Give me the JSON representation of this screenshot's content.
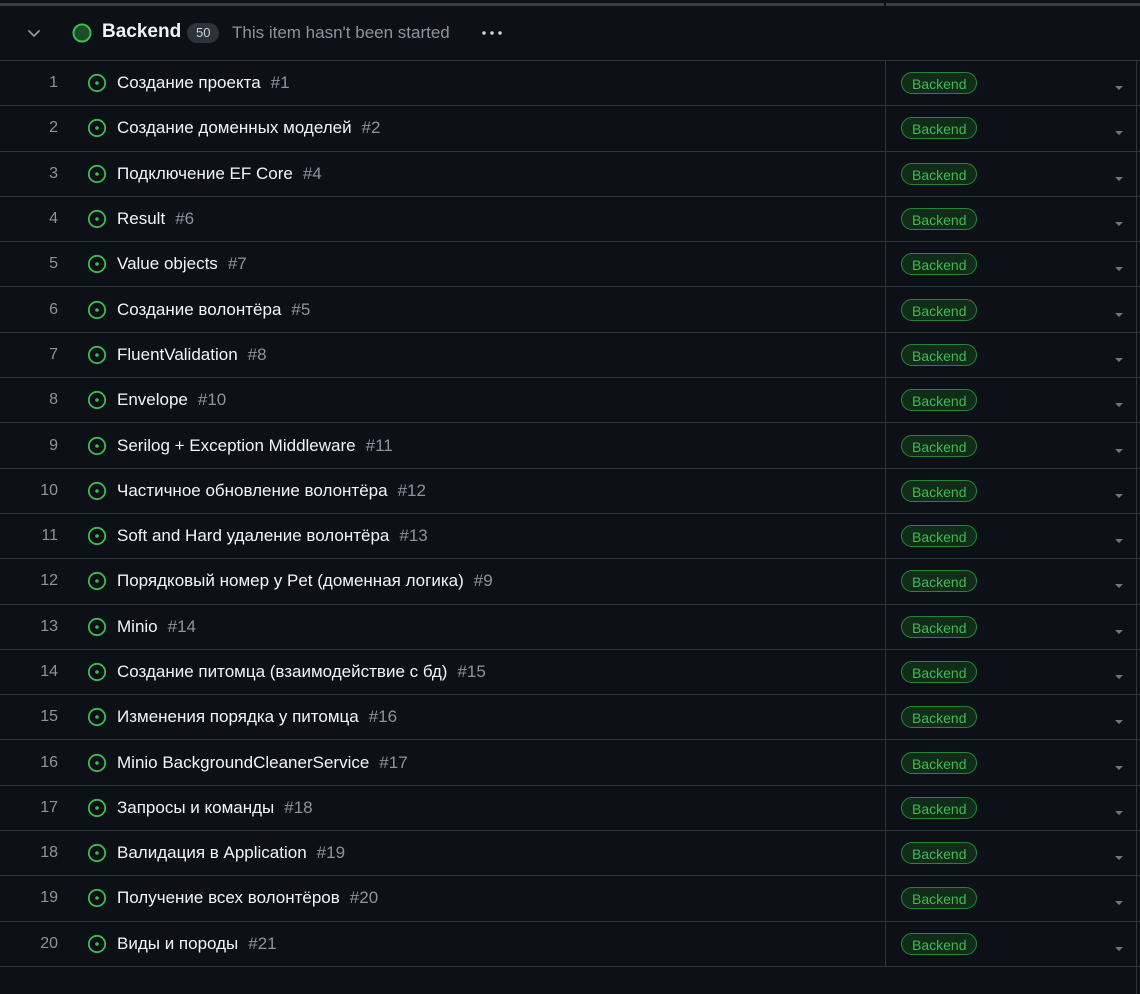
{
  "group": {
    "title": "Backend",
    "count": "50",
    "description": "This item hasn't been started"
  },
  "colors": {
    "background": "#0d1117",
    "label_text": "#3fb950",
    "status_green": "#3fb950"
  },
  "icons": {
    "collapse": "chevron-down-icon",
    "status": "status-circle-icon",
    "more": "kebab-menu-icon",
    "issue": "issue-open-icon",
    "dropdown": "dropdown-caret-icon"
  },
  "items": [
    {
      "num": "1",
      "title": "Создание проекта",
      "ref": "#1",
      "label": "Backend"
    },
    {
      "num": "2",
      "title": "Создание доменных моделей",
      "ref": "#2",
      "label": "Backend"
    },
    {
      "num": "3",
      "title": "Подключение EF Core",
      "ref": "#4",
      "label": "Backend"
    },
    {
      "num": "4",
      "title": "Result",
      "ref": "#6",
      "label": "Backend"
    },
    {
      "num": "5",
      "title": "Value objects",
      "ref": "#7",
      "label": "Backend"
    },
    {
      "num": "6",
      "title": "Создание волонтёра",
      "ref": "#5",
      "label": "Backend"
    },
    {
      "num": "7",
      "title": "FluentValidation",
      "ref": "#8",
      "label": "Backend"
    },
    {
      "num": "8",
      "title": "Envelope",
      "ref": "#10",
      "label": "Backend"
    },
    {
      "num": "9",
      "title": "Serilog + Exception Middleware",
      "ref": "#11",
      "label": "Backend"
    },
    {
      "num": "10",
      "title": "Частичное обновление волонтёра",
      "ref": "#12",
      "label": "Backend"
    },
    {
      "num": "11",
      "title": "Soft and Hard удаление волонтёра",
      "ref": "#13",
      "label": "Backend"
    },
    {
      "num": "12",
      "title": "Порядковый номер у Pet (доменная логика)",
      "ref": "#9",
      "label": "Backend"
    },
    {
      "num": "13",
      "title": "Minio",
      "ref": "#14",
      "label": "Backend"
    },
    {
      "num": "14",
      "title": "Создание питомца (взаимодействие с бд)",
      "ref": "#15",
      "label": "Backend"
    },
    {
      "num": "15",
      "title": "Изменения порядка у питомца",
      "ref": "#16",
      "label": "Backend"
    },
    {
      "num": "16",
      "title": "Minio BackgroundCleanerService",
      "ref": "#17",
      "label": "Backend"
    },
    {
      "num": "17",
      "title": "Запросы и команды",
      "ref": "#18",
      "label": "Backend"
    },
    {
      "num": "18",
      "title": "Валидация в Application",
      "ref": "#19",
      "label": "Backend"
    },
    {
      "num": "19",
      "title": "Получение всех волонтёров",
      "ref": "#20",
      "label": "Backend"
    },
    {
      "num": "20",
      "title": "Виды и породы",
      "ref": "#21",
      "label": "Backend"
    }
  ]
}
